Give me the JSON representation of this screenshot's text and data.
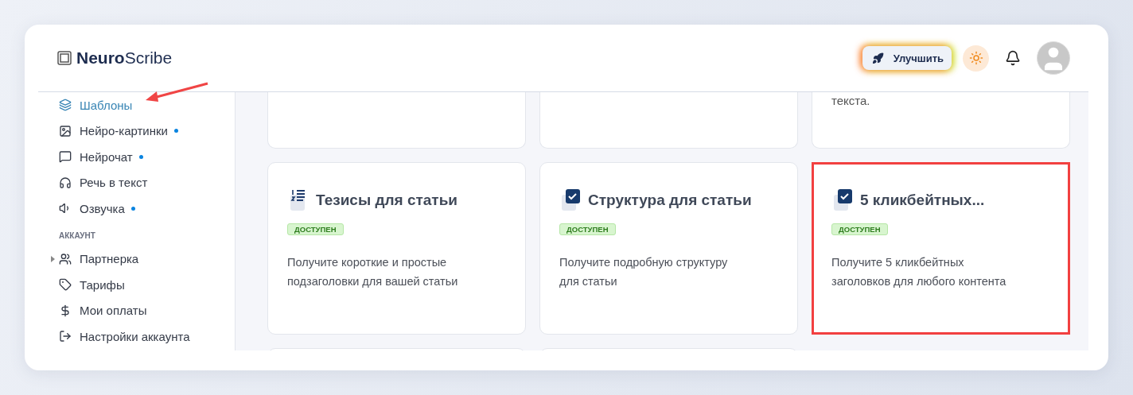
{
  "header": {
    "logo": "**Neuro**Scribe",
    "upgrade_button": "Улучшить"
  },
  "sidebar": {
    "items": [
      {
        "label": "Шаблоны",
        "selected": true,
        "dot": false
      },
      {
        "label": "Нейро-картинки",
        "selected": false,
        "dot": true
      },
      {
        "label": "Нейрочат",
        "selected": false,
        "dot": true
      },
      {
        "label": "Речь в текст",
        "selected": false,
        "dot": false
      },
      {
        "label": "Озвучка",
        "selected": false,
        "dot": true
      }
    ],
    "section_title": "АККАУНТ",
    "account_items": [
      {
        "label": "Партнерка",
        "selected": false,
        "expandable": true
      },
      {
        "label": "Тарифы",
        "selected": false,
        "expandable": false
      },
      {
        "label": "Мои оплаты",
        "selected": false,
        "expandable": false
      },
      {
        "label": "Настройки аккаунта",
        "selected": false,
        "expandable": false
      }
    ]
  },
  "top_card_text": "текста.",
  "cards": [
    {
      "kind": "list",
      "title": "Тезисы для статьи",
      "badge": "ДОСТУПЕН",
      "description": "Получите короткие и простые подзаголовки для вашей статьи",
      "highlighted": false
    },
    {
      "kind": "check",
      "title": "Структура для статьи",
      "badge": "ДОСТУПЕН",
      "description": "Получите подробную структуру для статьи",
      "highlighted": false
    },
    {
      "kind": "check",
      "title": "5 кликбейтных...",
      "badge": "ДОСТУПЕН",
      "description": "Получите 5 кликбейтных заголовков для любого контента",
      "highlighted": true
    }
  ]
}
